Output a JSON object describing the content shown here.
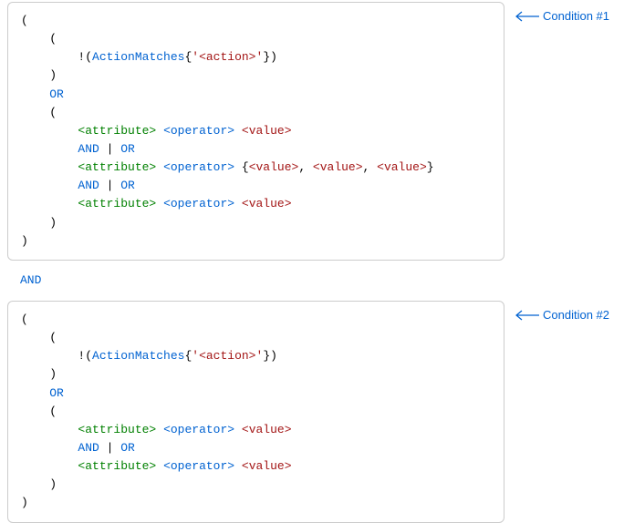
{
  "labels": {
    "condition1": "Condition #1",
    "condition2": "Condition #2"
  },
  "tokens": {
    "open_paren": "(",
    "close_paren": ")",
    "open_brace": "{",
    "close_brace": "}",
    "comma_sp": ", ",
    "bang_open": "!(",
    "action_matches": "ActionMatches",
    "squote": "'",
    "action_ph": "<action>",
    "or": "OR",
    "and": "AND",
    "pipe": " | ",
    "attribute_ph": "<attribute>",
    "operator_ph": "<operator>",
    "value_ph": "<value>"
  },
  "between_and": "AND",
  "colors": {
    "blue": "#0062d1",
    "green": "#008000",
    "red": "#a31515"
  }
}
